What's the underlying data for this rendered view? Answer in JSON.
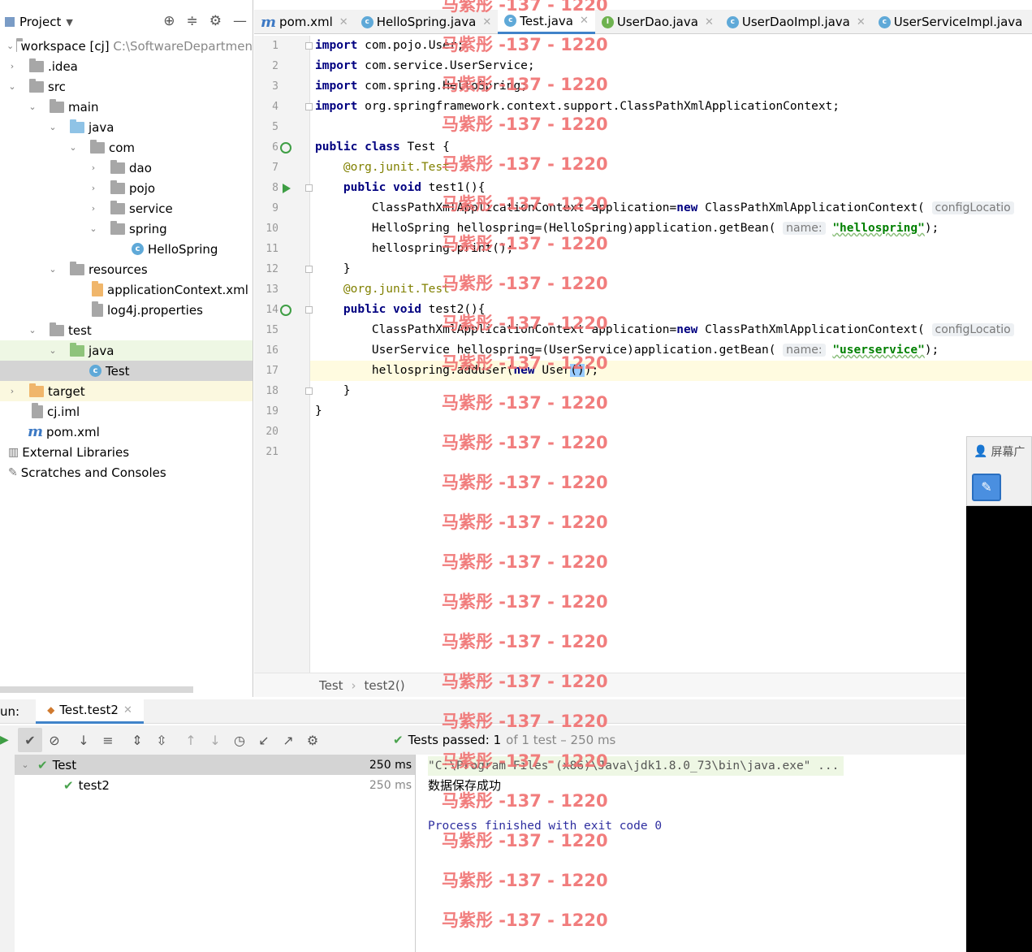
{
  "project": {
    "title": "Project",
    "tree": [
      {
        "label": "workspace [cj]",
        "extra": "C:\\SoftwareDepartmen"
      },
      {
        "label": ".idea"
      },
      {
        "label": "src"
      },
      {
        "label": "main"
      },
      {
        "label": "java"
      },
      {
        "label": "com"
      },
      {
        "label": "dao"
      },
      {
        "label": "pojo"
      },
      {
        "label": "service"
      },
      {
        "label": "spring"
      },
      {
        "label": "HelloSpring"
      },
      {
        "label": "resources"
      },
      {
        "label": "applicationContext.xml"
      },
      {
        "label": "log4j.properties"
      },
      {
        "label": "test"
      },
      {
        "label": "java"
      },
      {
        "label": "Test"
      },
      {
        "label": "target"
      },
      {
        "label": "cj.iml"
      },
      {
        "label": "pom.xml"
      },
      {
        "label": "External Libraries"
      },
      {
        "label": "Scratches and Consoles"
      }
    ]
  },
  "tabs": [
    {
      "label": "pom.xml",
      "icon": "maven-icon"
    },
    {
      "label": "HelloSpring.java",
      "icon": "class-icon"
    },
    {
      "label": "Test.java",
      "icon": "class-icon",
      "active": true
    },
    {
      "label": "UserDao.java",
      "icon": "interface-icon"
    },
    {
      "label": "UserDaoImpl.java",
      "icon": "class-icon"
    },
    {
      "label": "UserServiceImpl.java",
      "icon": "class-icon"
    }
  ],
  "editor": {
    "line_numbers": [
      "1",
      "2",
      "3",
      "4",
      "5",
      "6",
      "7",
      "8",
      "9",
      "10",
      "11",
      "12",
      "13",
      "14",
      "15",
      "16",
      "17",
      "18",
      "19",
      "20",
      "21"
    ],
    "current_line": "17",
    "hint_config": "configLocatio",
    "hint_name": "name:",
    "str_hellospring": "\"hellospring\"",
    "str_userservice": "\"userservice\""
  },
  "breadcrumb": {
    "class": "Test",
    "method": "test2()"
  },
  "run": {
    "label": "un:",
    "tab": "Test.test2",
    "status": "Tests passed: 1",
    "status_detail": "of 1 test – 250 ms",
    "tree": [
      {
        "name": "Test",
        "time": "250 ms"
      },
      {
        "name": "test2",
        "time": "250 ms"
      }
    ],
    "console": [
      "\"C:\\Program Files (x86)\\Java\\jdk1.8.0_73\\bin\\java.exe\" ...",
      "数据保存成功",
      "Process finished with exit code 0"
    ]
  },
  "popup": {
    "title": "屏幕广"
  },
  "watermark": "马紫彤 -137 - 1220"
}
